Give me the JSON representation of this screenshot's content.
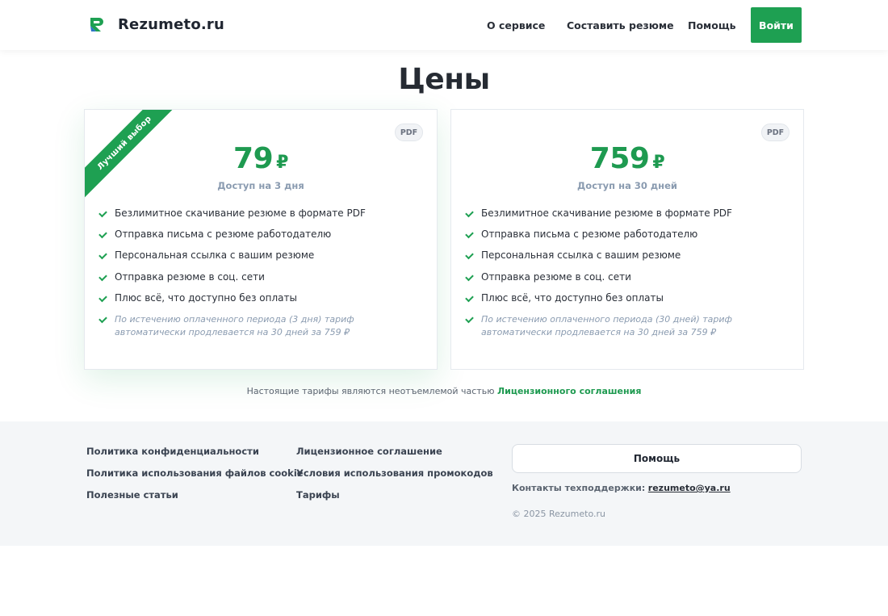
{
  "header": {
    "logo_icon": "rezumeto-logo-icon",
    "brand": "Rezumeto.ru",
    "nav": {
      "about": "О сервисе",
      "compose": "Составить резюме",
      "help": "Помощь"
    },
    "login": "Войти"
  },
  "page": {
    "title": "Цены"
  },
  "plans": [
    {
      "ribbon": "Лучший выбор",
      "badge": "PDF",
      "price": "79",
      "currency": "₽",
      "period": "Доступ на 3 дня",
      "features": [
        "Безлимитное скачивание резюме в формате PDF",
        "Отправка письма с резюме работодателю",
        "Персональная ссылка с вашим резюме",
        "Отправка резюме в соц. сети",
        "Плюс всё, что доступно без оплаты"
      ],
      "note": "По истечению оплаченного периода (3 дня) тариф автоматически продлевается на 30 дней за 759 ₽"
    },
    {
      "badge": "PDF",
      "price": "759",
      "currency": "₽",
      "period": "Доступ на 30 дней",
      "features": [
        "Безлимитное скачивание резюме в формате PDF",
        "Отправка письма с резюме работодателю",
        "Персональная ссылка с вашим резюме",
        "Отправка резюме в соц. сети",
        "Плюс всё, что доступно без оплаты"
      ],
      "note": "По истечению оплаченного периода (30 дней) тариф автоматически продлевается на 30 дней за 759 ₽"
    }
  ],
  "agreement": {
    "text": "Настоящие тарифы являются неотъемлемой частью",
    "link": "Лицензионного соглашения"
  },
  "footer": {
    "col1": [
      "Политика конфиденциальности",
      "Политика использования файлов cookie",
      "Полезные статьи"
    ],
    "col2": [
      "Лицензионное соглашение",
      "Условия использования промокодов",
      "Тарифы"
    ],
    "help_button": "Помощь",
    "contacts_label": "Контакты техподдержки:",
    "contacts_email": "rezumeto@ya.ru",
    "copyright": "© 2025 Rezumeto.ru"
  },
  "colors": {
    "accent": "#1ea052",
    "price": "#1e9a50",
    "muted": "#8a9bb0",
    "footer_bg": "#f4f6f8"
  }
}
